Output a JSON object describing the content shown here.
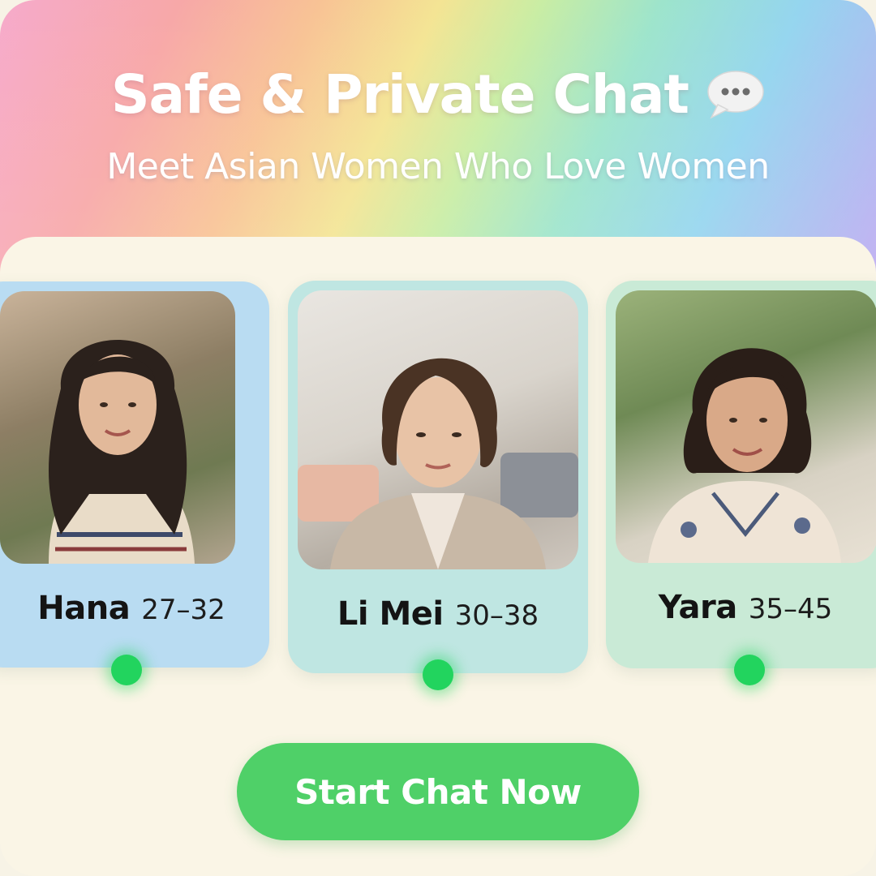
{
  "header": {
    "title": "Safe & Private Chat",
    "title_icon": "speech-bubble-icon",
    "subtitle": "Meet Asian Women Who Love Women"
  },
  "profiles": [
    {
      "name": "Hana",
      "age_range": "27–32",
      "online": true,
      "status_color": "#22d45e"
    },
    {
      "name": "Li Mei",
      "age_range": "30–38",
      "online": true,
      "status_color": "#22d45e"
    },
    {
      "name": "Yara",
      "age_range": "35–45",
      "online": true,
      "status_color": "#22d45e"
    }
  ],
  "cta": {
    "label": "Start Chat Now",
    "color": "#4fd068"
  },
  "colors": {
    "gradient": [
      "#f6a6c9",
      "#f8c08f",
      "#f3e38e",
      "#98e3c9",
      "#8fd3ee",
      "#b9a6f0"
    ],
    "panel": "#faf5e6"
  }
}
